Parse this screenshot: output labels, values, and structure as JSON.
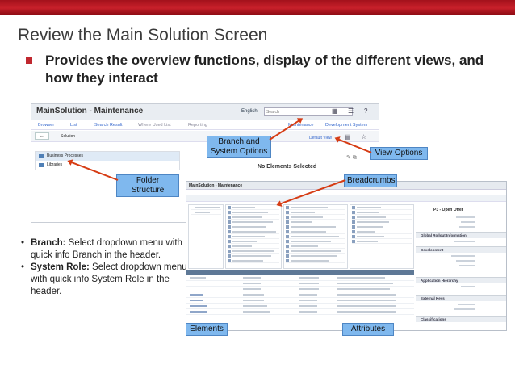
{
  "slide": {
    "title": "Review the Main Solution Screen",
    "bullet": "Provides the overview functions, display of the different views, and how they interact",
    "notes": [
      {
        "label": "Branch:",
        "text": " Select dropdown menu with quick info Branch in the header."
      },
      {
        "label": "System Role:",
        "text": " Select dropdown menu with quick info System Role in the header."
      }
    ]
  },
  "main_screenshot": {
    "title": "MainSolution - Maintenance",
    "language": "English",
    "search_placeholder": "Search",
    "nav": [
      "Browser",
      "List",
      "Search Result",
      "Where Used List",
      "Reporting",
      "Maintenance",
      "Development System"
    ],
    "back_label": "←",
    "solution_label": "Solution",
    "default_view": "Default View",
    "tree": [
      "Business Processes",
      "Libraries"
    ],
    "empty_message": "No Elements Selected"
  },
  "inner_screenshot": {
    "title": "MainSolution - Maintenance",
    "right_title": "P3 - Open Offer",
    "sections": [
      "Global Rollout Information",
      "Development",
      "Application Hierarchy",
      "External Keys",
      "Classifications"
    ]
  },
  "callouts": {
    "branch": "Branch and System Options",
    "view_options": "View Options",
    "folder_structure": "Folder Structure",
    "breadcrumbs": "Breadcrumbs",
    "elements": "Elements",
    "attributes": "Attributes"
  },
  "colors": {
    "accent_red": "#c0282f",
    "callout_blue": "#7fb8ee",
    "arrow": "#d63c14"
  }
}
